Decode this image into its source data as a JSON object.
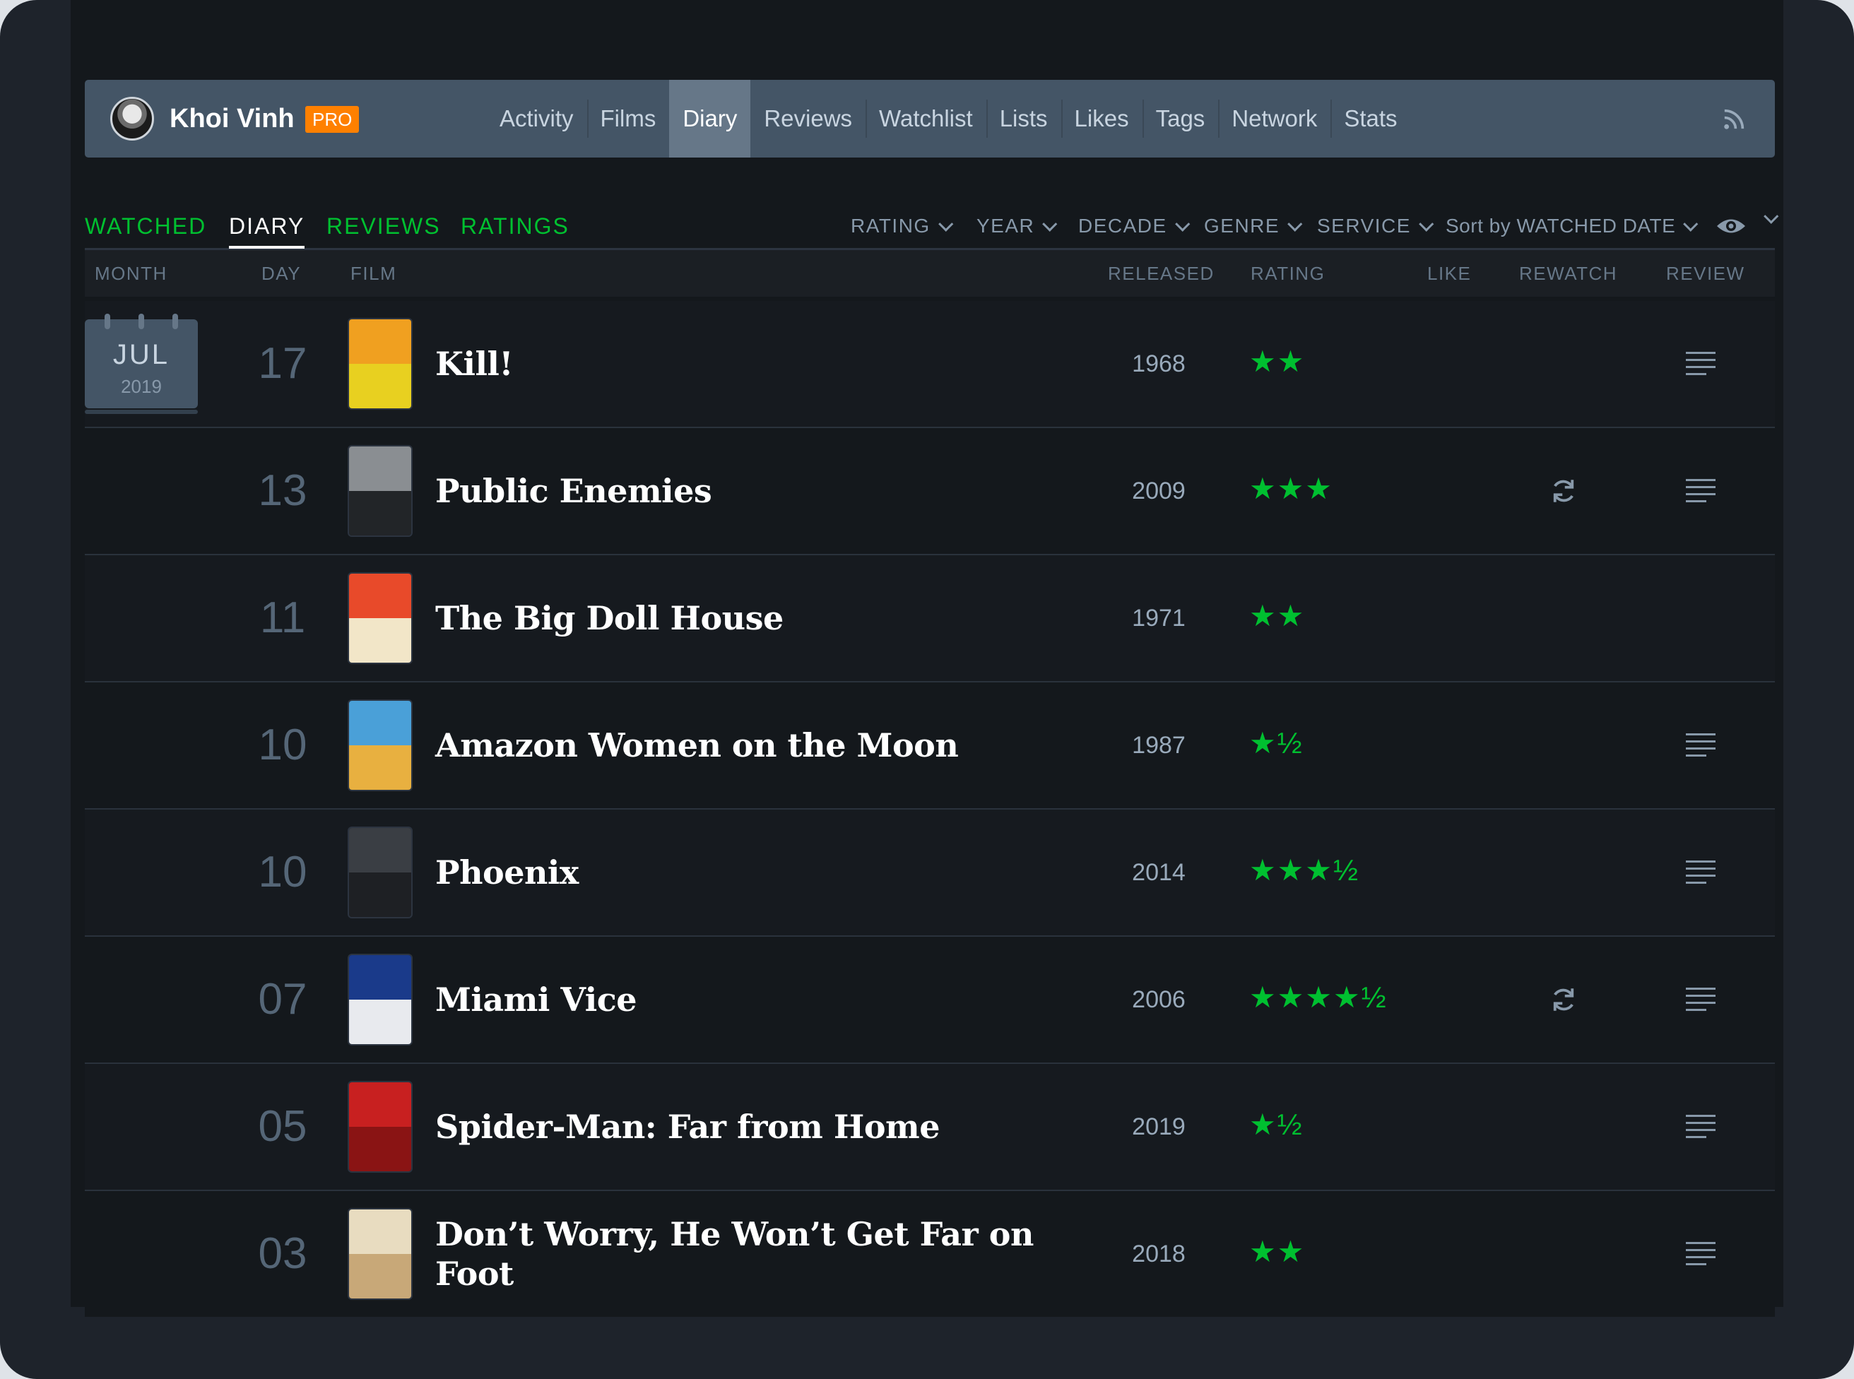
{
  "profile": {
    "username": "Khoi Vinh",
    "badge": "PRO"
  },
  "nav": {
    "tabs": [
      {
        "label": "Activity",
        "active": false
      },
      {
        "label": "Films",
        "active": false
      },
      {
        "label": "Diary",
        "active": true
      },
      {
        "label": "Reviews",
        "active": false
      },
      {
        "label": "Watchlist",
        "active": false
      },
      {
        "label": "Lists",
        "active": false
      },
      {
        "label": "Likes",
        "active": false
      },
      {
        "label": "Tags",
        "active": false
      },
      {
        "label": "Network",
        "active": false
      },
      {
        "label": "Stats",
        "active": false
      }
    ],
    "rss_icon": "rss-icon"
  },
  "subnav": {
    "tabs": [
      {
        "label": "WATCHED",
        "active": false
      },
      {
        "label": "DIARY",
        "active": true
      },
      {
        "label": "REVIEWS",
        "active": false
      },
      {
        "label": "RATINGS",
        "active": false
      }
    ],
    "filters": [
      "RATING",
      "YEAR",
      "DECADE",
      "GENRE",
      "SERVICE",
      "Sort by WATCHED DATE"
    ],
    "visibility_icon": "eye-icon"
  },
  "columns": {
    "month": "MONTH",
    "day": "DAY",
    "film": "FILM",
    "released": "RELEASED",
    "rating": "RATING",
    "like": "LIKE",
    "rewatch": "REWATCH",
    "review": "REVIEW"
  },
  "month_group": {
    "month": "JUL",
    "year": "2019"
  },
  "entries": [
    {
      "day": "17",
      "title": "Kill!",
      "released": "1968",
      "rating": "★★",
      "rewatch": false,
      "review": true
    },
    {
      "day": "13",
      "title": "Public Enemies",
      "released": "2009",
      "rating": "★★★",
      "rewatch": true,
      "review": true
    },
    {
      "day": "11",
      "title": "The Big Doll House",
      "released": "1971",
      "rating": "★★",
      "rewatch": false,
      "review": false
    },
    {
      "day": "10",
      "title": "Amazon Women on the Moon",
      "released": "1987",
      "rating": "★½",
      "rewatch": false,
      "review": true
    },
    {
      "day": "10",
      "title": "Phoenix",
      "released": "2014",
      "rating": "★★★½",
      "rewatch": false,
      "review": true
    },
    {
      "day": "07",
      "title": "Miami Vice",
      "released": "2006",
      "rating": "★★★★½",
      "rewatch": true,
      "review": true
    },
    {
      "day": "05",
      "title": "Spider-Man: Far from Home",
      "released": "2019",
      "rating": "★½",
      "rewatch": false,
      "review": true
    },
    {
      "day": "03",
      "title": "Don’t Worry, He Won’t Get Far on Foot",
      "released": "2018",
      "rating": "★★",
      "rewatch": false,
      "review": true
    }
  ],
  "colors": {
    "accent_green": "#00c030",
    "pro_orange": "#ff8000",
    "nav_bg": "#445566",
    "active_tab": "#667788"
  }
}
